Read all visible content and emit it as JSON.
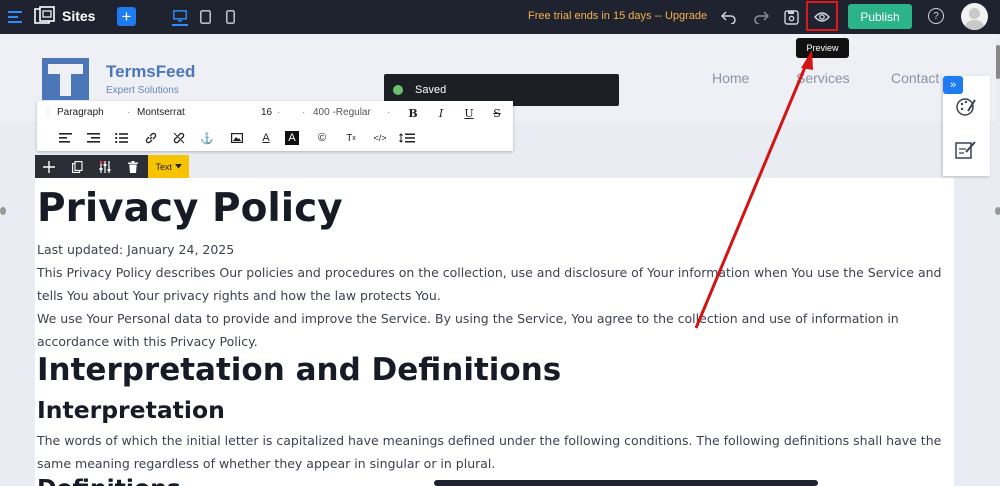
{
  "topbar": {
    "sites_label": "Sites",
    "trial_text": "Free trial ends in 15 days",
    "upgrade_label": "Upgrade",
    "publish_label": "Publish",
    "help_label": "?",
    "add_label": "+"
  },
  "tooltip": {
    "preview": "Preview"
  },
  "site": {
    "brand": "TermsFeed",
    "tagline": "Expert Solutions",
    "nav": [
      "Home",
      "Services",
      "Contact"
    ]
  },
  "toast": {
    "saved": "Saved"
  },
  "format_toolbar": {
    "block": "Paragraph",
    "font": "Montserrat",
    "size": "16",
    "weight": "400 -Regular",
    "bold": "B",
    "italic": "I",
    "underline": "U",
    "strike": "S"
  },
  "element_toolbar": {
    "type_label": "Text"
  },
  "content": {
    "title": "Privacy Policy",
    "updated": "Last updated: January 24, 2025",
    "p1_line1": "This Privacy Policy describes Our policies and procedures on the collection, use and disclosure of Your information when You use the Service and",
    "p1_line2": "tells You about Your privacy rights and how the law protects You.",
    "p2_line1": "We use Your Personal data to provide and improve the Service. By using the Service, You agree to the collection and use of information in",
    "p2_line2": "accordance with this Privacy Policy.",
    "h_interp_def": "Interpretation and Definitions",
    "h_interp": "Interpretation",
    "p3_line1": "The words of which the initial letter is capitalized have meanings defined under the following conditions. The following definitions shall have the",
    "p3_line2": "same meaning regardless of whether they appear in singular or in plural.",
    "h_definitions_partial": "Definitions"
  },
  "colors": {
    "topbar_bg": "#1f2330",
    "accent": "#1e7bf2",
    "publish": "#2bb38a",
    "trial": "#f5b14b",
    "annotation": "#e01818"
  }
}
